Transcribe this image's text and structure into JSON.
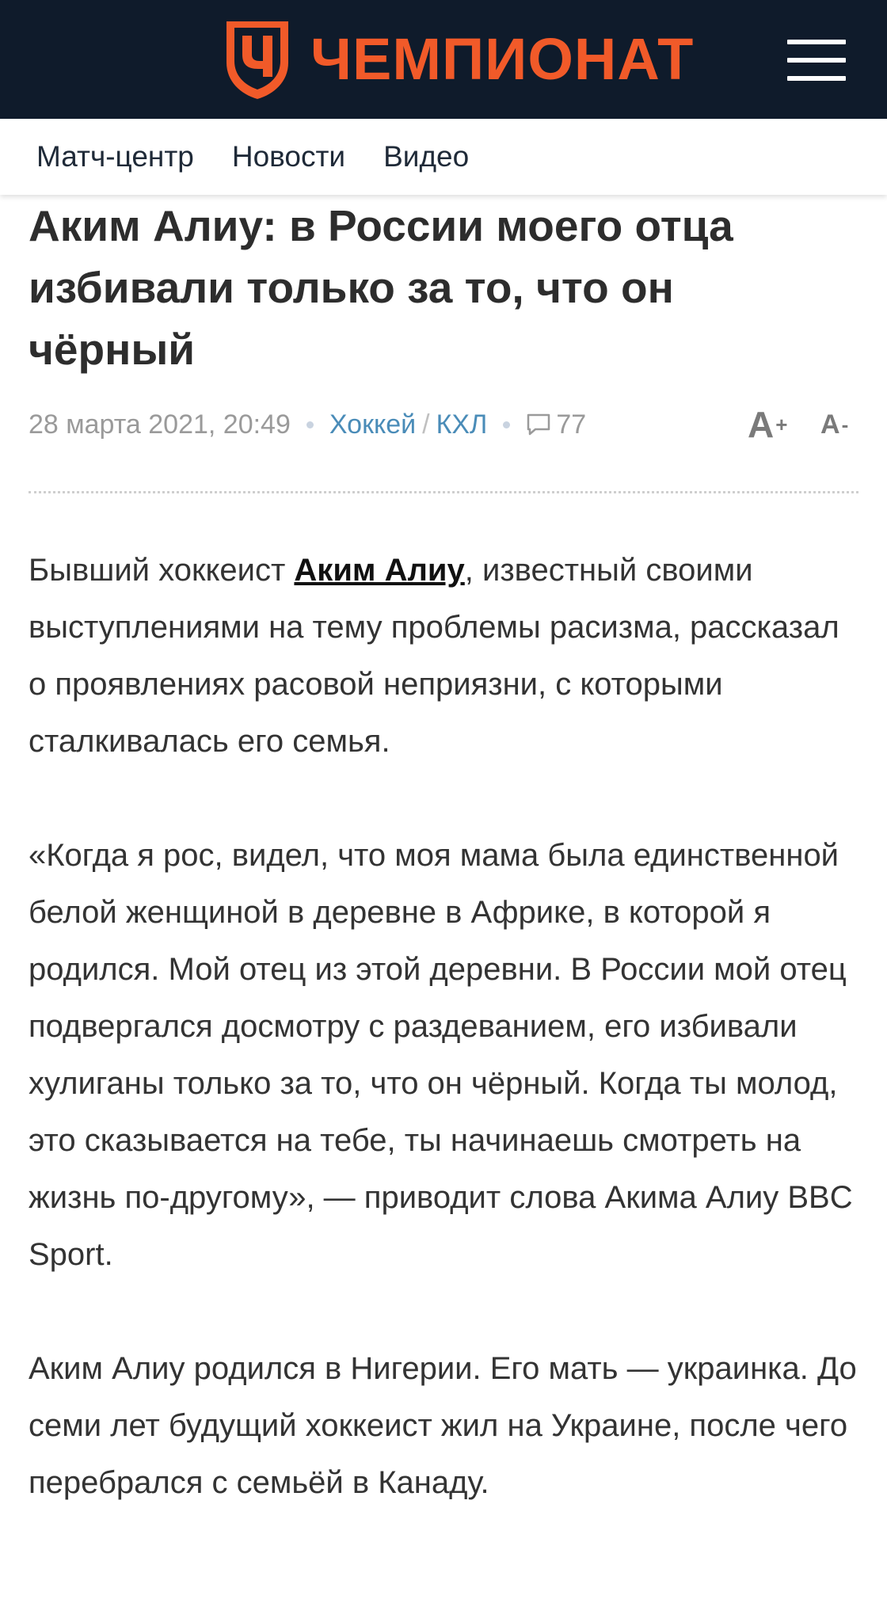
{
  "header": {
    "logo_text": "ЧЕМПИОНАТ",
    "brand_color": "#f15a29",
    "background": "#0f1b2b",
    "menu_icon": "hamburger-icon"
  },
  "subnav": {
    "items": [
      {
        "label": "Матч-центр"
      },
      {
        "label": "Новости"
      },
      {
        "label": "Видео"
      }
    ]
  },
  "article": {
    "title": "Аким Алиу: в России моего отца избивали только за то, что он чёрный",
    "meta": {
      "date": "28 марта 2021, 20:49",
      "category": "Хоккей",
      "separator": "/",
      "subcategory": "КХЛ",
      "comments_icon": "comment-icon",
      "comments_count": "77",
      "font_increase": "А",
      "font_increase_sign": "+",
      "font_decrease": "А",
      "font_decrease_sign": "-"
    },
    "p1": {
      "before": "Бывший хоккеист ",
      "person": "Аким Алиу",
      "after": ", известный своими выступлениями на тему проблемы расизма, рассказал о проявлениях расовой неприязни, с которыми сталкивалась его семья."
    },
    "p2": "«Когда я рос, видел, что моя мама была единственной белой женщиной в деревне в Африке, в которой я родился. Мой отец из этой деревни. В России мой отец подвергался досмотру с раздеванием, его избивали хулиганы только за то, что он чёрный. Когда ты молод, это сказывается на тебе, ты начинаешь смотреть на жизнь по-другому», — приводит слова Акима Алиу BBC Sport.",
    "p3": "Аким Алиу родился в Нигерии. Его мать — украинка. До семи лет будущий хоккеист жил на Украине, после чего перебрался с семьёй в Канаду."
  }
}
